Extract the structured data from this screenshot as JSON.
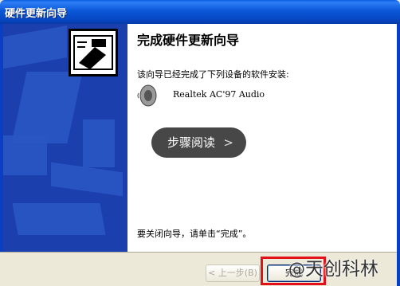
{
  "window": {
    "title": "硬件更新向导"
  },
  "wizard": {
    "heading": "完成硬件更新向导",
    "intro": "该向导已经完成了下列设备的软件安装:",
    "device_name": "Realtek AC'97 Audio",
    "finish_instruction": "要关闭向导，请单击“完成”。"
  },
  "buttons": {
    "back": "< 上一步(B)",
    "finish": "完成"
  },
  "overlay": {
    "label": "步骤阅读",
    "chevron": ">"
  },
  "watermark": {
    "mark": "@",
    "text": "天创科林"
  }
}
